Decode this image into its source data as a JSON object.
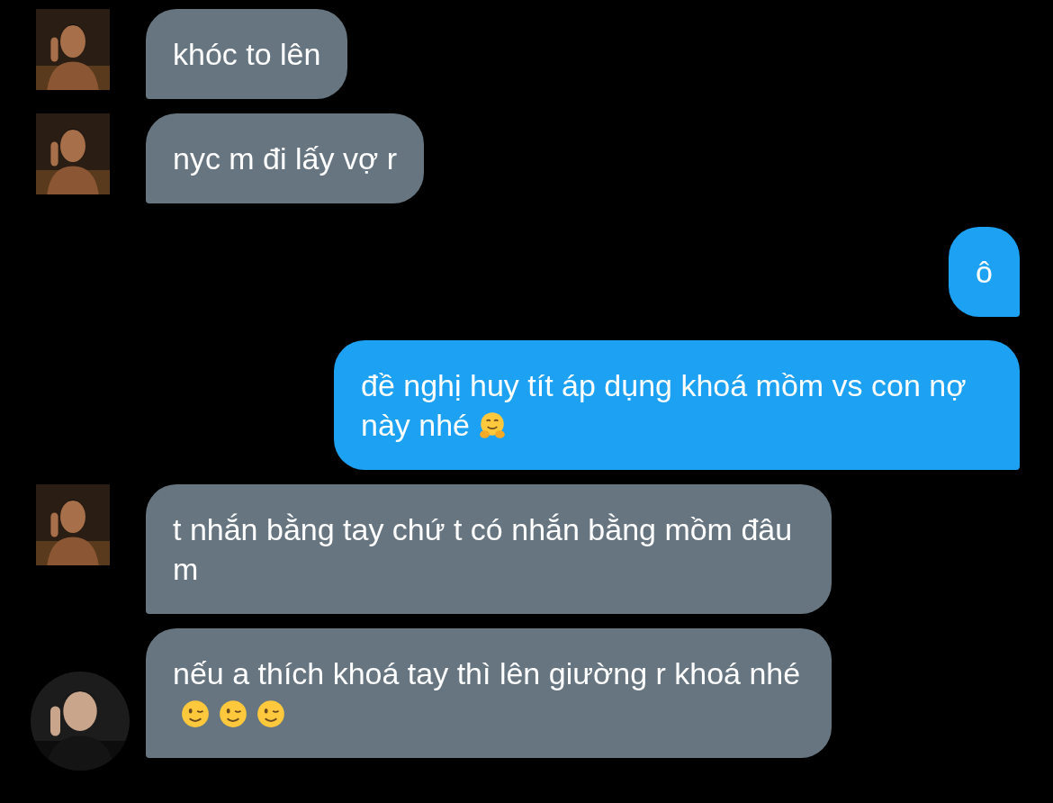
{
  "messages": [
    {
      "kind": "received",
      "avatar": {
        "kind": "square"
      },
      "text": "khóc to lên"
    },
    {
      "kind": "received",
      "avatar": {
        "kind": "square"
      },
      "text": "nyc m đi lấy vợ r"
    },
    {
      "kind": "sent",
      "text": "ô"
    },
    {
      "kind": "sent",
      "text": "đề nghị huy tít áp dụng khoá mồm vs con nợ này nhé",
      "emojis": [
        {
          "kind": "hugging"
        }
      ]
    },
    {
      "kind": "received",
      "avatar": {
        "kind": "square"
      },
      "text": "t nhắn bằng tay chứ t có nhắn bằng mồm đâu m"
    },
    {
      "kind": "received",
      "avatar": {
        "kind": "round"
      },
      "text": "nếu a thích khoá tay thì lên giường r khoá nhé",
      "emojis": [
        {
          "kind": "wink"
        },
        {
          "kind": "wink"
        },
        {
          "kind": "wink"
        }
      ]
    }
  ]
}
